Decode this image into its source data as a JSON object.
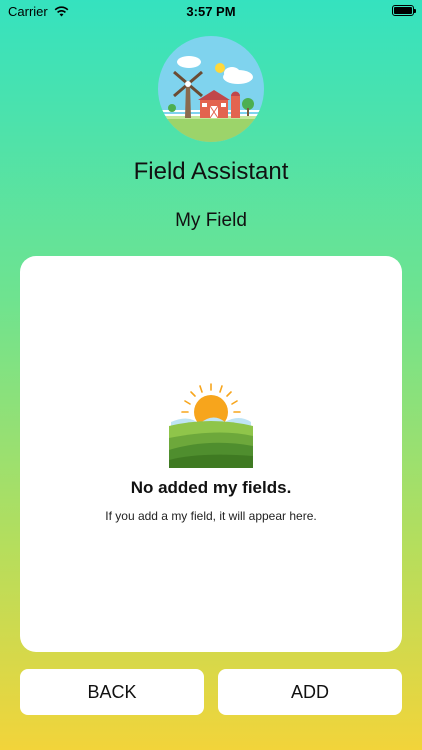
{
  "status_bar": {
    "carrier": "Carrier",
    "time": "3:57 PM"
  },
  "header": {
    "app_title": "Field Assistant",
    "section_title": "My Field"
  },
  "empty_state": {
    "title": "No added my fields.",
    "subtitle": "If you add a my field, it will appear here."
  },
  "buttons": {
    "back_label": "BACK",
    "add_label": "ADD"
  },
  "colors": {
    "gradient_top": "#35e2bf",
    "gradient_bottom": "#f2d43a",
    "card_background": "#ffffff"
  },
  "icons": [
    "wifi-icon",
    "battery-icon",
    "farm-logo-icon",
    "sun-field-icon"
  ]
}
